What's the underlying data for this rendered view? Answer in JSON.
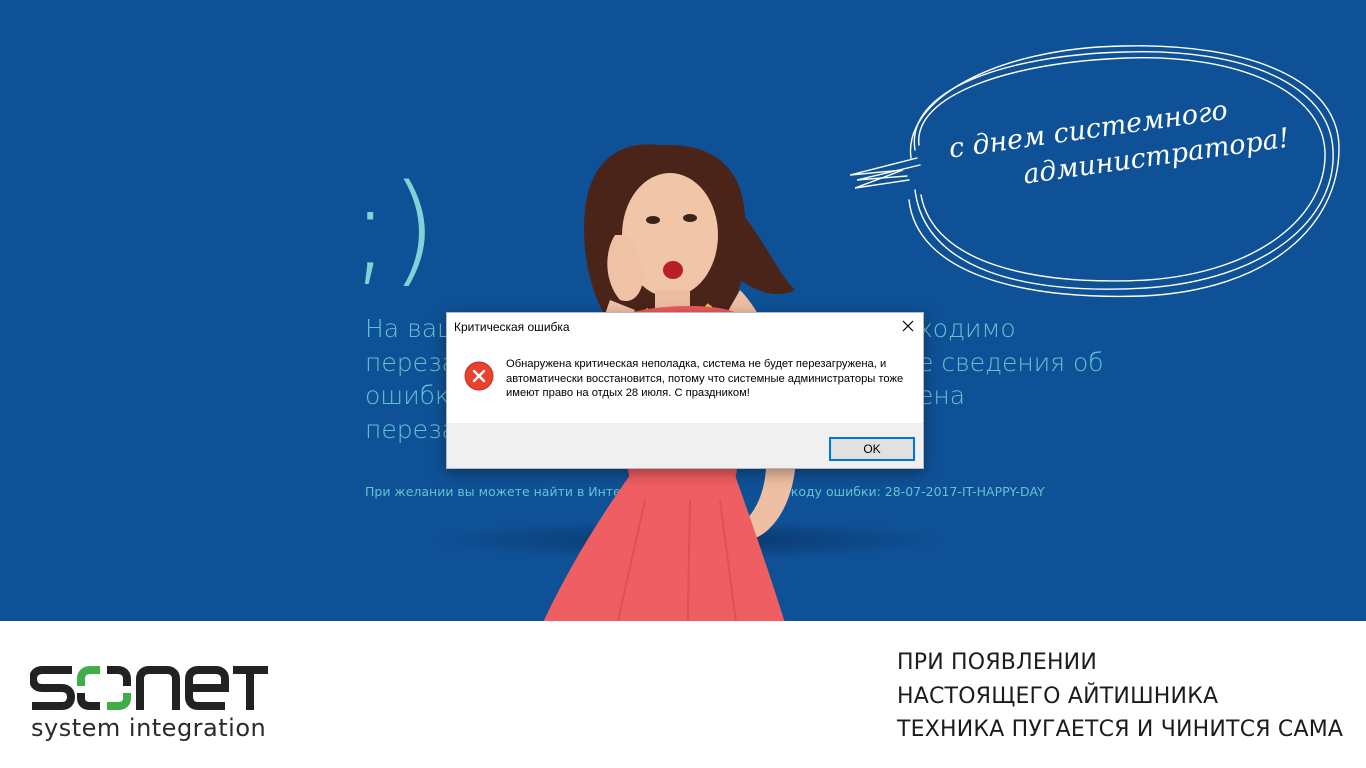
{
  "bsod": {
    "smiley": ";)",
    "message_lines": [
      "На ваш",
      "переза",
      "ошибк",
      "переза"
    ],
    "message_right_lines": [
      "ходимо",
      "е сведения об",
      "ена",
      ""
    ],
    "code_left": "При желании вы можете найти в Интерн",
    "code_right": "му коду ошибки: 28-07-2017-IT-HAPPY-DAY"
  },
  "bubble": {
    "line1": "с днем системного",
    "line2": "администратора!"
  },
  "dialog": {
    "title": "Критическая ошибка",
    "message": "Обнаружена критическая неполадка, система не будет перезагружена, и автоматически восстановится, потому что системные администраторы тоже имеют право на отдых 28 июля. С праздником!",
    "ok_label": "OK"
  },
  "footer": {
    "logo_text": "sonet",
    "logo_tagline": "system integration",
    "slogan": [
      "ПРИ ПОЯВЛЕНИИ",
      "НАСТОЯЩЕГО АЙТИШНИКА",
      "ТЕХНИКА ПУГАЕТСЯ И ЧИНИТСЯ САМА"
    ]
  },
  "colors": {
    "bsod_bg": "#0f5196",
    "bsod_text": "#62c3cf",
    "error_red": "#e8412d",
    "logo_green": "#3fae49"
  }
}
